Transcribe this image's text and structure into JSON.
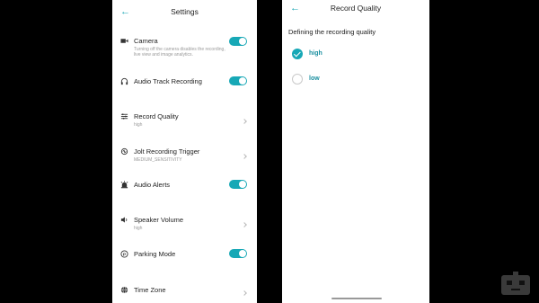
{
  "settings": {
    "back_icon": "arrow-left-icon",
    "title": "Settings",
    "rows": [
      {
        "icon": "video-camera-icon",
        "label": "Camera",
        "sub": "Turning off the camera disables the recording,",
        "sub2": "live view and image analytics.",
        "control": "toggle",
        "on": true
      },
      {
        "icon": "headphones-icon",
        "label": "Audio Track Recording",
        "control": "toggle",
        "on": true
      },
      {
        "icon": "sliders-icon",
        "label": "Record Quality",
        "sub": "high",
        "control": "chevron"
      },
      {
        "icon": "vibration-icon",
        "label": "Jolt Recording Trigger",
        "sub": "MEDIUM_SENSITIVITY",
        "control": "chevron"
      },
      {
        "icon": "alarm-bell-icon",
        "label": "Audio Alerts",
        "control": "toggle",
        "on": true
      },
      {
        "icon": "speaker-icon",
        "label": "Speaker Volume",
        "sub": "high",
        "control": "chevron"
      },
      {
        "icon": "parking-icon",
        "label": "Parking Mode",
        "control": "toggle",
        "on": true
      },
      {
        "icon": "globe-icon",
        "label": "Time Zone",
        "control": "chevron"
      }
    ]
  },
  "record_quality": {
    "back_icon": "arrow-left-icon",
    "title": "Record Quality",
    "heading": "Defining the recording quality",
    "options": [
      {
        "label": "high",
        "selected": true
      },
      {
        "label": "low",
        "selected": false
      }
    ]
  },
  "colors": {
    "accent": "#17a8b6",
    "background": "#000000",
    "panel": "#ffffff"
  },
  "brand_icon": "robot-logo-icon"
}
